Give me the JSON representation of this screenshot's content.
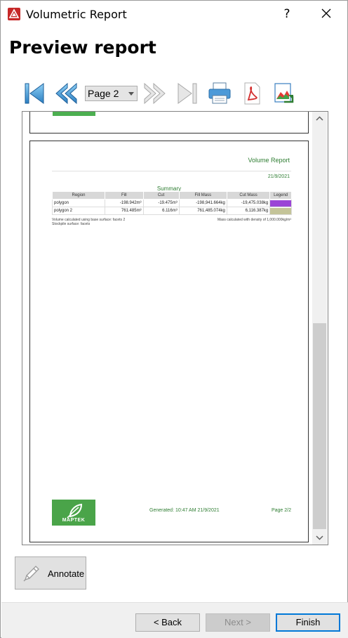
{
  "window": {
    "title": "Volumetric Report",
    "help_label": "?"
  },
  "heading": "Preview report",
  "toolbar": {
    "page_select_value": "Page 2",
    "icons": [
      "first-page-icon",
      "previous-page-icon",
      "next-page-icon",
      "last-page-icon",
      "print-icon",
      "pdf-icon",
      "export-image-icon"
    ]
  },
  "report": {
    "title": "Volume Report",
    "date": "21/9/2021",
    "summary_title": "Summary",
    "columns": [
      "Region",
      "Fill",
      "Cut",
      "Fill Mass",
      "Cut Mass",
      "Legend"
    ],
    "rows": [
      {
        "region": "polygon",
        "fill": "-198.942m³",
        "cut": "-19.475m³",
        "fill_mass": "-198,941.664kg",
        "cut_mass": "-19,475.038kg",
        "legend_color": "#9b45d6"
      },
      {
        "region": "polygon 2",
        "fill": "761.485m³",
        "cut": "6.116m³",
        "fill_mass": "761,485.074kg",
        "cut_mass": "6,116.387kg",
        "legend_color": "#c4c499"
      }
    ],
    "note_left_1": "Volume calculated using base surface: facets 2",
    "note_left_2": "Stockpile surface: facets",
    "note_right": "Mass calculated with density of 1,000.000kg/m³",
    "logo_text": "MAPTEK",
    "generated": "Generated: 10:47 AM 21/9/2021",
    "page_number": "Page 2/2"
  },
  "annotate_label": "Annotate",
  "footer": {
    "back_label": "< Back",
    "next_label": "Next >",
    "finish_label": "Finish"
  },
  "colors": {
    "accent": "#0078d7",
    "report_green": "#2e7d32",
    "maptek_green": "#4aa449"
  }
}
